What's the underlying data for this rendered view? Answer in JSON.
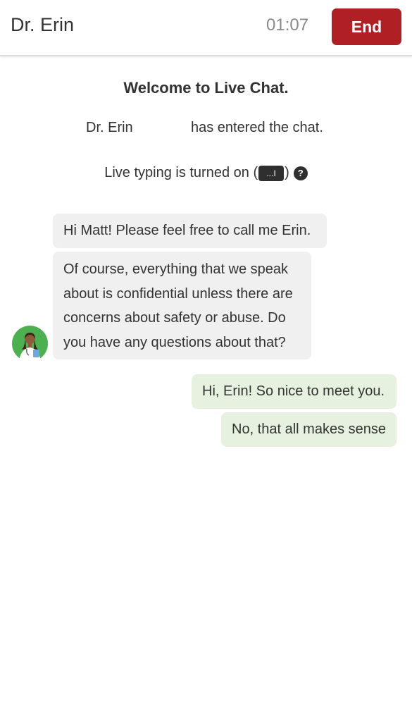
{
  "header": {
    "title": "Dr. Erin",
    "timer": "01:07",
    "end_label": "End",
    "end_color": "#b01f24"
  },
  "system": {
    "welcome": "Welcome to Live Chat.",
    "entered_name": "Dr. Erin",
    "entered_text": "has entered the chat.",
    "typing_prefix": "Live typing is turned on (",
    "typing_badge": "...I",
    "typing_suffix": ")",
    "help_icon": "question-circle-icon"
  },
  "messages": [
    {
      "from": "agent",
      "text": "Hi Matt! Please feel free to call me Erin."
    },
    {
      "from": "agent",
      "text": "Of course, everything that we speak about is confidential unless there are concerns about safety or abuse. Do you have any questions about that?"
    },
    {
      "from": "user",
      "text": "Hi, Erin! So nice to meet you."
    },
    {
      "from": "user",
      "text": "No, that all makes sense"
    }
  ],
  "colors": {
    "agent_bubble": "#f0f0f0",
    "user_bubble": "#e6f2df",
    "avatar_bg": "#4caf50"
  },
  "avatar_icon": "doctor-avatar-icon"
}
